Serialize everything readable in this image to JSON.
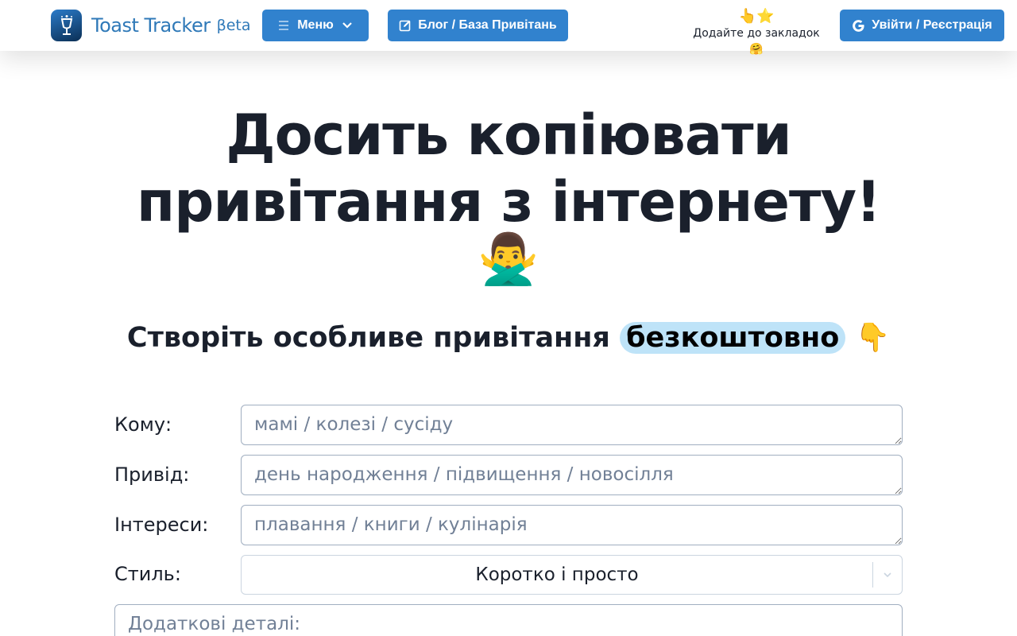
{
  "header": {
    "logo_text": "Toast Tracker",
    "logo_beta": "βeta",
    "menu_label": "Меню",
    "blog_label": "Блог / База Привітань",
    "bookmark_emoji": "👆⭐",
    "bookmark_text": "Додайте до закладок 🤗",
    "login_label": "Увійти / Реєстрація",
    "accent_color": "#3182ce"
  },
  "hero": {
    "title_line1": "Досить копіювати",
    "title_line2": "привітання з інтернету!",
    "emoji": "🙅‍♂️",
    "subtitle": "Створіть особливе привітання",
    "highlight": "безкоштовно",
    "subtitle_emoji": "👇"
  },
  "form": {
    "to_label": "Кому:",
    "to_placeholder": "мамі / колезі / сусіду",
    "reason_label": "Привід:",
    "reason_placeholder": "день народження / підвищення / новосілля",
    "interests_label": "Інтереси:",
    "interests_placeholder": "плавання / книги / кулінарія",
    "style_label": "Стиль:",
    "style_value": "Коротко і просто",
    "details_placeholder": "Додаткові деталі:"
  }
}
